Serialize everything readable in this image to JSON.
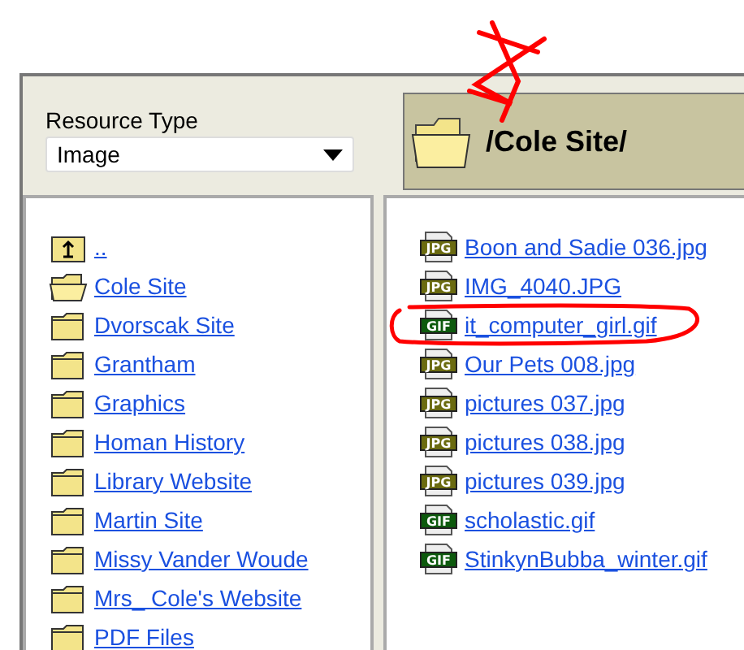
{
  "resource_type": {
    "label": "Resource Type",
    "value": "Image"
  },
  "current_folder": {
    "path": "/Cole Site/",
    "starred": true
  },
  "folders": [
    {
      "kind": "up",
      "label": ".."
    },
    {
      "kind": "open",
      "label": "Cole Site"
    },
    {
      "kind": "folder",
      "label": "Dvorscak Site"
    },
    {
      "kind": "folder",
      "label": "Grantham"
    },
    {
      "kind": "folder",
      "label": "Graphics"
    },
    {
      "kind": "folder",
      "label": "Homan History"
    },
    {
      "kind": "folder",
      "label": "Library Website"
    },
    {
      "kind": "folder",
      "label": "Martin Site"
    },
    {
      "kind": "folder",
      "label": "Missy Vander Woude"
    },
    {
      "kind": "folder",
      "label": "Mrs_ Cole's Website"
    },
    {
      "kind": "folder",
      "label": "PDF Files"
    }
  ],
  "files": [
    {
      "kind": "jpg",
      "badge": "JPG",
      "label": "Boon and Sadie 036.jpg",
      "circled": false
    },
    {
      "kind": "jpg",
      "badge": "JPG",
      "label": "IMG_4040.JPG",
      "circled": false
    },
    {
      "kind": "gif",
      "badge": "GIF",
      "label": "it_computer_girl.gif",
      "circled": true
    },
    {
      "kind": "jpg",
      "badge": "JPG",
      "label": "Our Pets 008.jpg",
      "circled": false
    },
    {
      "kind": "jpg",
      "badge": "JPG",
      "label": "pictures 037.jpg",
      "circled": false
    },
    {
      "kind": "jpg",
      "badge": "JPG",
      "label": "pictures 038.jpg",
      "circled": false
    },
    {
      "kind": "jpg",
      "badge": "JPG",
      "label": "pictures 039.jpg",
      "circled": false
    },
    {
      "kind": "gif",
      "badge": "GIF",
      "label": "scholastic.gif",
      "circled": false
    },
    {
      "kind": "gif",
      "badge": "GIF",
      "label": "StinkynBubba_winter.gif",
      "circled": false
    }
  ]
}
